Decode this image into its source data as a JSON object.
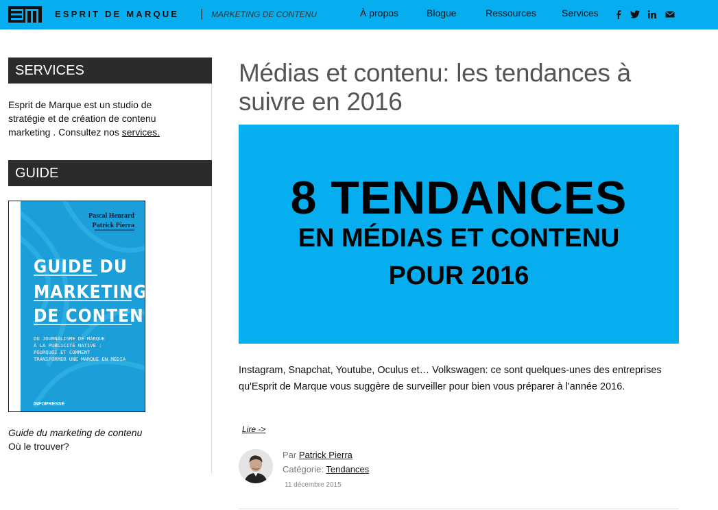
{
  "header": {
    "logo": "EM",
    "brand_name": "ESPRIT DE MARQUE",
    "separator": "|",
    "tagline": "MARKETING DE CONTENU",
    "nav": [
      "À propos",
      "Blogue",
      "Ressources",
      "Services"
    ],
    "social_icons": [
      "facebook-icon",
      "twitter-icon",
      "linkedin-icon",
      "email-icon"
    ],
    "bar_color": "#06aef0"
  },
  "sidebar": {
    "services_heading": "SERVICES",
    "services_text": "Esprit de Marque est un studio de stratégie et de création de contenu marketing . Consultez nos ",
    "services_link": "services.",
    "guide_heading": "GUIDE",
    "book": {
      "author1": "Pascal Henrard",
      "author2": "Patrick Pierra",
      "title_line1": "GUIDE DU",
      "title_line2": "MARKETING",
      "title_line3": "DE CONTENU",
      "subtitle_line1": "DU JOURNALISME DE MARQUE",
      "subtitle_line2": "À LA PUBLICITÉ NATIVE :",
      "subtitle_line3": "POURQUOI ET COMMENT",
      "subtitle_line4": "TRANSFORMER UNE MARQUE EN MÉDIA",
      "publisher": "INFOPRESSE",
      "cover_color": "#1c9fd9"
    },
    "caption_title": "Guide du marketing de contenu",
    "caption_link": "Où le trouver?"
  },
  "article": {
    "title": "Médias et contenu: les tendances à suivre en 2016",
    "banner": {
      "line1": "8 TENDANCES",
      "line2": "EN MÉDIAS ET CONTENU",
      "line3": "POUR 2016",
      "bg_color": "#06aef0"
    },
    "excerpt": "Instagram, Snapchat, Youtube, Oculus et… Volkswagen: ce sont quelques-unes des entreprises qu'Esprit de Marque vous suggère de surveiller pour bien vous préparer à l'année 2016.",
    "read_more": "Lire ->",
    "author_prefix": "Par",
    "author": "Patrick Pierra",
    "category_prefix": "Catégorie:",
    "category": "Tendances",
    "date": "11 décembre 2015"
  }
}
